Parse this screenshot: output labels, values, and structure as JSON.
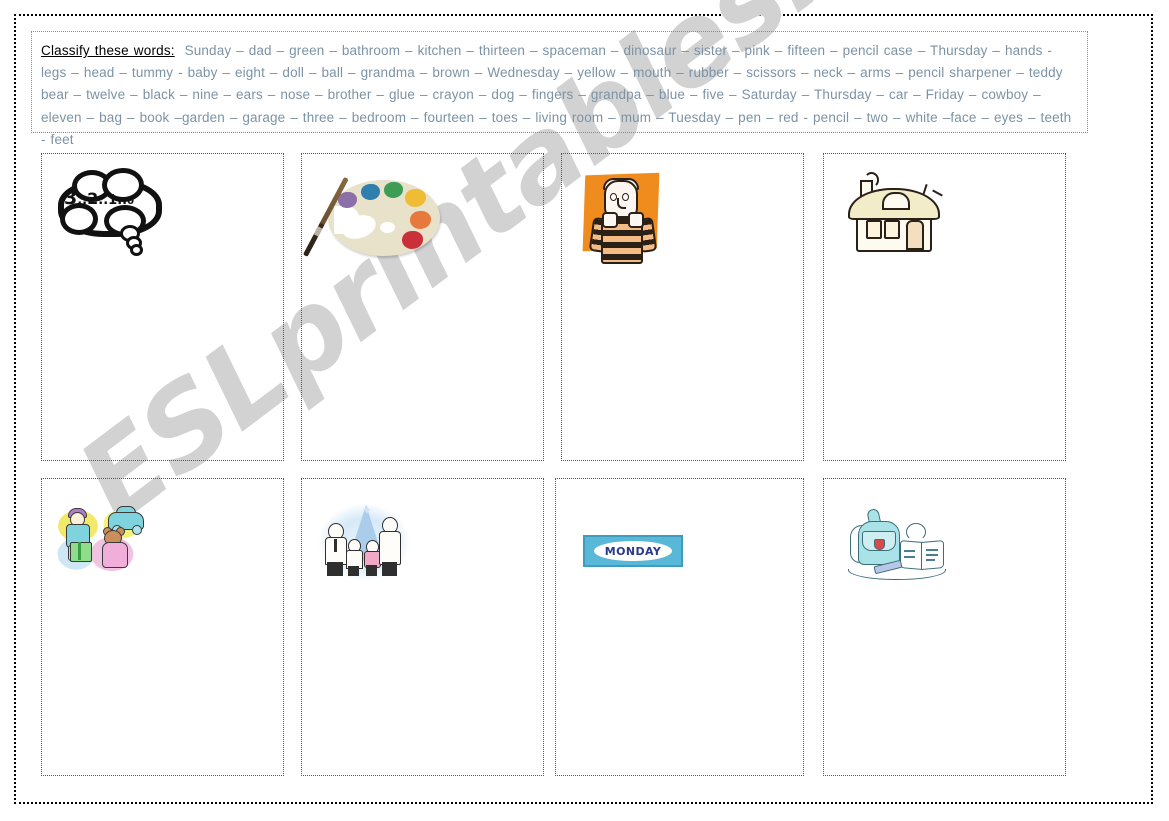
{
  "worksheet": {
    "instruction_label": "Classify these words:",
    "word_list": "Sunday – dad – green – bathroom – kitchen – thirteen – spaceman – dinosaur – sister – pink – fifteen – pencil case – Thursday – hands - legs – head – tummy -  baby – eight – doll – ball – grandma – brown – Wednesday – yellow – mouth – rubber – scissors – neck – arms – pencil sharpener – teddy bear – twelve – black – nine – ears – nose – brother – glue – crayon – dog – fingers – grandpa – blue – five – Saturday – Thursday – car – Friday – cowboy – eleven – bag – book –garden – garage – three – bedroom – fourteen – toes – living room – mum – Tuesday – pen – red -  pencil – two – white –face – eyes – teeth - feet",
    "watermark": "ESLprintables.com",
    "text_color": "#7c93a6",
    "border_color": "#000000"
  },
  "categories": [
    {
      "id": "numbers",
      "icon": "thought-bubble-countdown-icon",
      "caption": "3..2...1...0",
      "digits": [
        "3",
        "2",
        "1",
        "0"
      ]
    },
    {
      "id": "colours",
      "icon": "paint-palette-icon",
      "caption": "",
      "palette_colors": [
        "#8b6fa8",
        "#2f7fae",
        "#3f9c56",
        "#f0bc36",
        "#e8793d",
        "#c9303a"
      ]
    },
    {
      "id": "body-parts",
      "icon": "person-figure-icon",
      "caption": "",
      "accent": "#f08b1e"
    },
    {
      "id": "rooms",
      "icon": "house-icon",
      "caption": "",
      "accent": "#f2ecc8"
    },
    {
      "id": "toys",
      "icon": "toys-icon",
      "caption": "",
      "accent": "#f2e86a"
    },
    {
      "id": "family",
      "icon": "family-icon",
      "caption": "",
      "accent": "#a9cdeb"
    },
    {
      "id": "days-of-the-week",
      "icon": "monday-card-icon",
      "caption": "MONDAY",
      "accent": "#59b8d8"
    },
    {
      "id": "school-objects",
      "icon": "school-supplies-icon",
      "caption": "",
      "accent": "#a9e3e8"
    }
  ]
}
